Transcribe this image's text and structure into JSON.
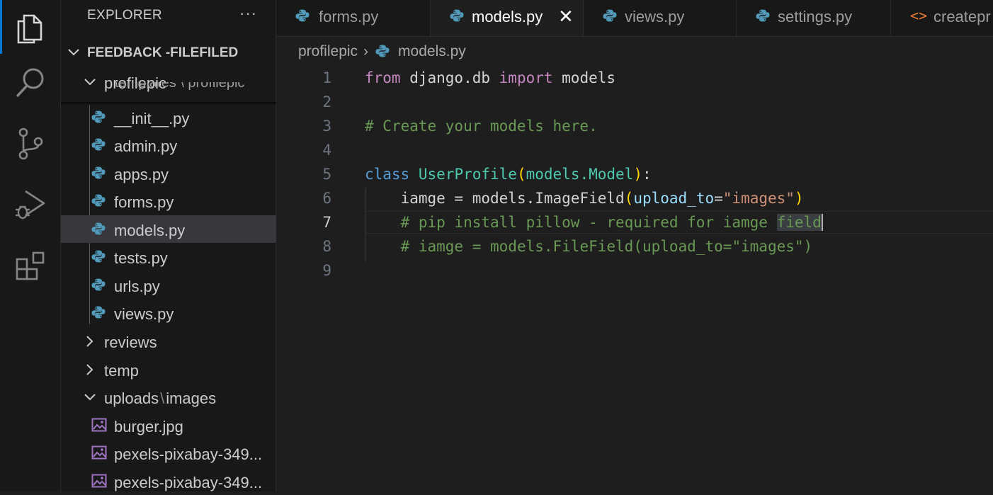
{
  "colors": {
    "accent": "#0078d4",
    "python_icon": "#519aba",
    "html_icon": "#e37933",
    "image_icon": "#a074c4"
  },
  "activity_bar": [
    {
      "icon": "explorer-icon"
    },
    {
      "icon": "search-icon"
    },
    {
      "icon": "source-control-icon"
    },
    {
      "icon": "run-debug-icon"
    },
    {
      "icon": "extensions-icon"
    }
  ],
  "sidebar": {
    "title": "EXPLORER",
    "more": "···",
    "workspace": "FEEDBACK -FILEFILED",
    "partial_row": "templates \\ profilepic",
    "items": [
      {
        "label": "profilepic",
        "type": "folder-open"
      },
      {
        "label": "__init__.py",
        "type": "python"
      },
      {
        "label": "admin.py",
        "type": "python"
      },
      {
        "label": "apps.py",
        "type": "python"
      },
      {
        "label": "forms.py",
        "type": "python"
      },
      {
        "label": "models.py",
        "type": "python",
        "selected": true
      },
      {
        "label": "tests.py",
        "type": "python"
      },
      {
        "label": "urls.py",
        "type": "python"
      },
      {
        "label": "views.py",
        "type": "python"
      },
      {
        "label": "reviews",
        "type": "folder-closed"
      },
      {
        "label": "temp",
        "type": "folder-closed"
      },
      {
        "label_a": "uploads",
        "label_sep": "\\",
        "label_b": "images",
        "type": "folder-open"
      },
      {
        "label": "burger.jpg",
        "type": "image"
      },
      {
        "label": "pexels-pixabay-349...",
        "type": "image"
      },
      {
        "label": "pexels-pixabay-349...",
        "type": "image"
      }
    ]
  },
  "tabs": [
    {
      "label": "forms.py",
      "icon": "python-icon"
    },
    {
      "label": "models.py",
      "icon": "python-icon",
      "active": true,
      "close": "✕"
    },
    {
      "label": "views.py",
      "icon": "python-icon"
    },
    {
      "label": "settings.py",
      "icon": "python-icon"
    },
    {
      "label": "createpr",
      "icon": "html-icon",
      "glyph": "<>"
    }
  ],
  "breadcrumb": {
    "folder": "profilepic",
    "sep": "›",
    "file": "models.py"
  },
  "editor": {
    "line_numbers": [
      "1",
      "2",
      "3",
      "4",
      "5",
      "6",
      "7",
      "8",
      "9"
    ],
    "current_line": "7",
    "lines": {
      "l1": {
        "from": "from",
        "mod": " django.db ",
        "import": "import",
        "name": " models"
      },
      "l3": {
        "comment": "# Create your models here."
      },
      "l5": {
        "class": "class",
        "sp": " ",
        "name": "UserProfile",
        "lp": "(",
        "base": "models.Model",
        "rp": ")",
        "colon": ":"
      },
      "l6": {
        "indent": "    ",
        "lhs": "iamge = models.ImageField",
        "lp": "(",
        "param": "upload_to",
        "eq": "=",
        "str": "\"images\"",
        "rp": ")"
      },
      "l7": {
        "indent": "    ",
        "comment_a": "# pip install pillow - required for iamge ",
        "comment_b": "field"
      },
      "l8": {
        "indent": "    ",
        "comment": "# iamge = models.FileField(upload_to=\"images\")"
      }
    }
  }
}
